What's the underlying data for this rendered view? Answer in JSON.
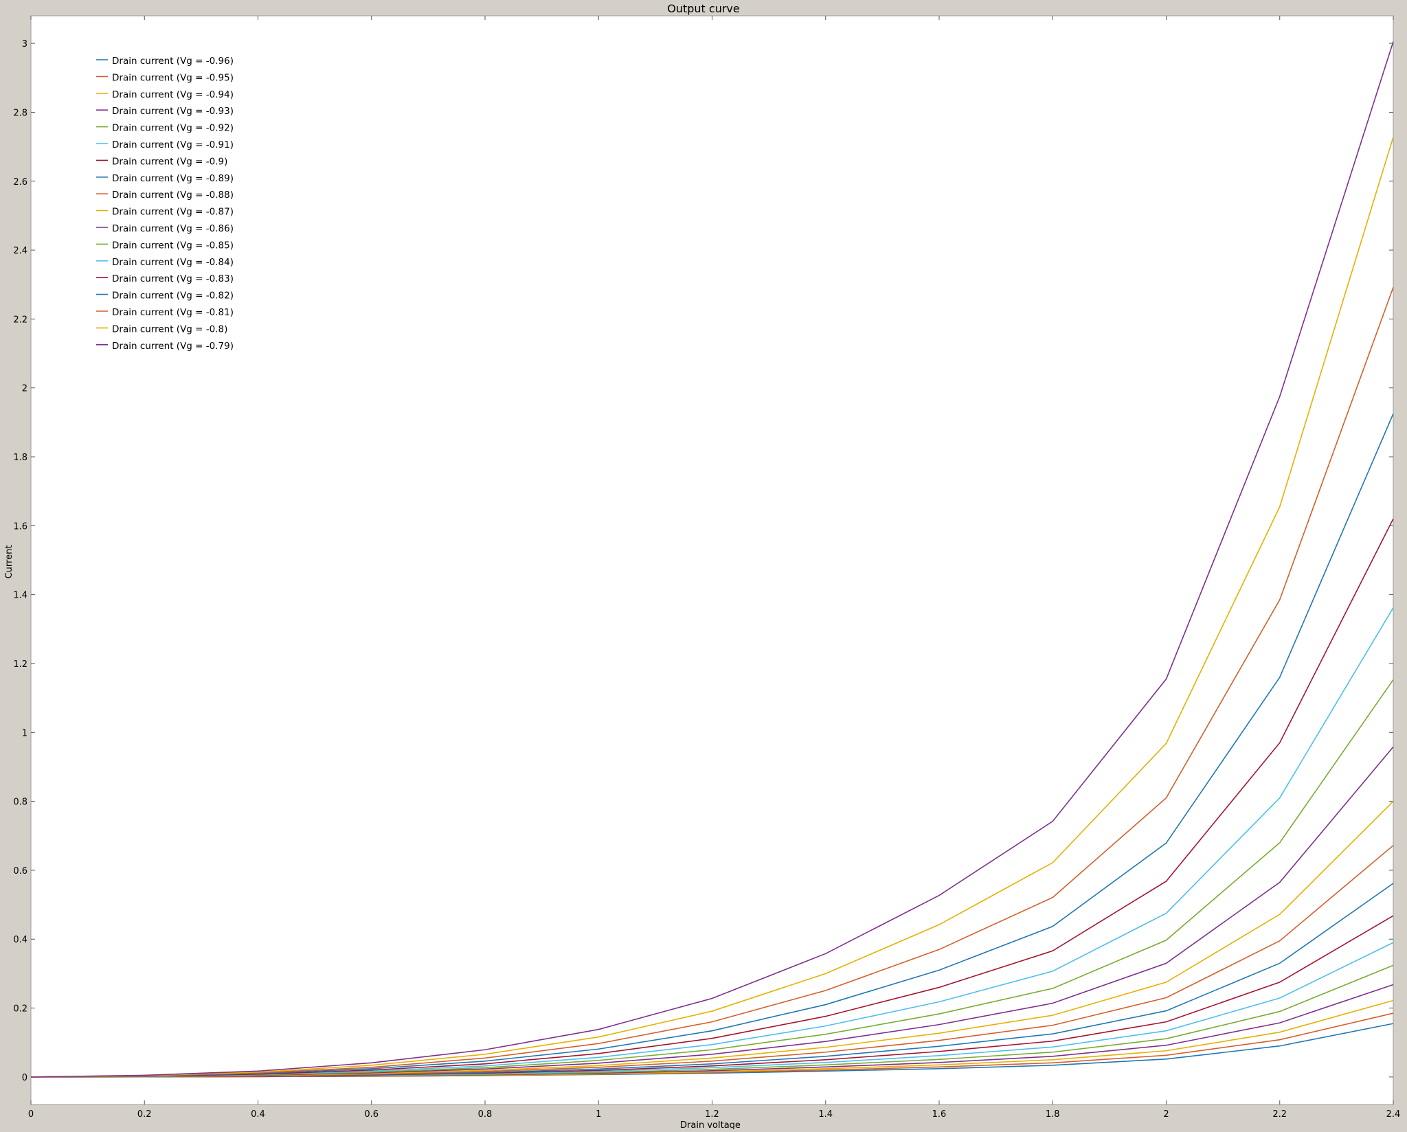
{
  "window": {
    "background": "#d4d0c8",
    "plot_background": "#ffffff"
  },
  "chart_data": {
    "type": "line",
    "title": "Output curve",
    "xlabel": "Drain voltage",
    "ylabel": "Current",
    "xlim": [
      0,
      2.4
    ],
    "ylim": [
      -0.08,
      3.08
    ],
    "xticks": [
      0,
      0.2,
      0.4,
      0.6,
      0.8,
      1,
      1.2,
      1.4,
      1.6,
      1.8,
      2,
      2.2,
      2.4
    ],
    "yticks": [
      0,
      0.2,
      0.4,
      0.6,
      0.8,
      1,
      1.2,
      1.4,
      1.6,
      1.8,
      2,
      2.2,
      2.4,
      2.6,
      2.8,
      3
    ],
    "grid": false,
    "legend_position": "top-left",
    "x": [
      0,
      0.2,
      0.4,
      0.6,
      0.8,
      1.0,
      1.2,
      1.4,
      1.6,
      1.8,
      2.0,
      2.2,
      2.4
    ],
    "series": [
      {
        "name": "Drain current (Vg = -0.96)",
        "color": "#1f77b4",
        "values": [
          0,
          0.0003,
          0.001,
          0.002,
          0.004,
          0.007,
          0.011,
          0.017,
          0.024,
          0.034,
          0.052,
          0.09,
          0.155
        ]
      },
      {
        "name": "Drain current (Vg = -0.95)",
        "color": "#d45f2a",
        "values": [
          0,
          0.0003,
          0.001,
          0.002,
          0.004,
          0.008,
          0.013,
          0.02,
          0.029,
          0.041,
          0.063,
          0.108,
          0.185
        ]
      },
      {
        "name": "Drain current (Vg = -0.94)",
        "color": "#e6b000",
        "values": [
          0,
          0.0004,
          0.001,
          0.003,
          0.005,
          0.009,
          0.015,
          0.024,
          0.035,
          0.05,
          0.076,
          0.13,
          0.222
        ]
      },
      {
        "name": "Drain current (Vg = -0.93)",
        "color": "#7e2f8e",
        "values": [
          0,
          0.0004,
          0.001,
          0.003,
          0.006,
          0.011,
          0.018,
          0.029,
          0.042,
          0.06,
          0.092,
          0.157,
          0.268
        ]
      },
      {
        "name": "Drain current (Vg = -0.92)",
        "color": "#77ac30",
        "values": [
          0,
          0.0005,
          0.002,
          0.004,
          0.007,
          0.013,
          0.022,
          0.035,
          0.051,
          0.072,
          0.111,
          0.19,
          0.324
        ]
      },
      {
        "name": "Drain current (Vg = -0.91)",
        "color": "#4dbeee",
        "values": [
          0,
          0.0006,
          0.002,
          0.005,
          0.009,
          0.016,
          0.027,
          0.042,
          0.062,
          0.087,
          0.134,
          0.229,
          0.39
        ]
      },
      {
        "name": "Drain current (Vg = -0.9)",
        "color": "#a2142f",
        "values": [
          0,
          0.0007,
          0.002,
          0.006,
          0.011,
          0.019,
          0.032,
          0.05,
          0.074,
          0.104,
          0.16,
          0.275,
          0.468
        ]
      },
      {
        "name": "Drain current (Vg = -0.89)",
        "color": "#1f77b4",
        "values": [
          0,
          0.0008,
          0.003,
          0.007,
          0.013,
          0.023,
          0.038,
          0.06,
          0.089,
          0.125,
          0.192,
          0.33,
          0.562
        ]
      },
      {
        "name": "Drain current (Vg = -0.88)",
        "color": "#d45f2a",
        "values": [
          0,
          0.001,
          0.003,
          0.008,
          0.016,
          0.028,
          0.046,
          0.072,
          0.106,
          0.15,
          0.23,
          0.395,
          0.672
        ]
      },
      {
        "name": "Drain current (Vg = -0.87)",
        "color": "#e6b000",
        "values": [
          0,
          0.001,
          0.004,
          0.01,
          0.019,
          0.033,
          0.055,
          0.086,
          0.127,
          0.179,
          0.275,
          0.472,
          0.8
        ]
      },
      {
        "name": "Drain current (Vg = -0.86)",
        "color": "#7e2f8e",
        "values": [
          0,
          0.0015,
          0.005,
          0.012,
          0.023,
          0.04,
          0.066,
          0.103,
          0.152,
          0.214,
          0.33,
          0.565,
          0.958
        ]
      },
      {
        "name": "Drain current (Vg = -0.85)",
        "color": "#77ac30",
        "values": [
          0,
          0.0018,
          0.006,
          0.014,
          0.027,
          0.048,
          0.079,
          0.124,
          0.183,
          0.257,
          0.397,
          0.68,
          1.153
        ]
      },
      {
        "name": "Drain current (Vg = -0.84)",
        "color": "#4dbeee",
        "values": [
          0,
          0.002,
          0.007,
          0.017,
          0.032,
          0.057,
          0.094,
          0.148,
          0.218,
          0.307,
          0.475,
          0.81,
          1.362
        ]
      },
      {
        "name": "Drain current (Vg = -0.83)",
        "color": "#a2142f",
        "values": [
          0,
          0.0025,
          0.008,
          0.02,
          0.038,
          0.068,
          0.112,
          0.176,
          0.26,
          0.366,
          0.568,
          0.97,
          1.62
        ]
      },
      {
        "name": "Drain current (Vg = -0.82)",
        "color": "#1f77b4",
        "values": [
          0,
          0.003,
          0.01,
          0.024,
          0.046,
          0.081,
          0.134,
          0.21,
          0.31,
          0.437,
          0.679,
          1.16,
          1.925
        ]
      },
      {
        "name": "Drain current (Vg = -0.81)",
        "color": "#d45f2a",
        "values": [
          0,
          0.0035,
          0.012,
          0.028,
          0.055,
          0.097,
          0.16,
          0.251,
          0.37,
          0.521,
          0.81,
          1.385,
          2.292
        ]
      },
      {
        "name": "Drain current (Vg = -0.8)",
        "color": "#e6b000",
        "values": [
          0,
          0.004,
          0.014,
          0.034,
          0.066,
          0.116,
          0.191,
          0.3,
          0.442,
          0.622,
          0.968,
          1.655,
          2.728
        ]
      },
      {
        "name": "Drain current (Vg = -0.79)",
        "color": "#7e2f8e",
        "values": [
          0,
          0.005,
          0.017,
          0.041,
          0.079,
          0.138,
          0.228,
          0.358,
          0.527,
          0.742,
          1.155,
          1.975,
          3.005
        ]
      }
    ]
  }
}
